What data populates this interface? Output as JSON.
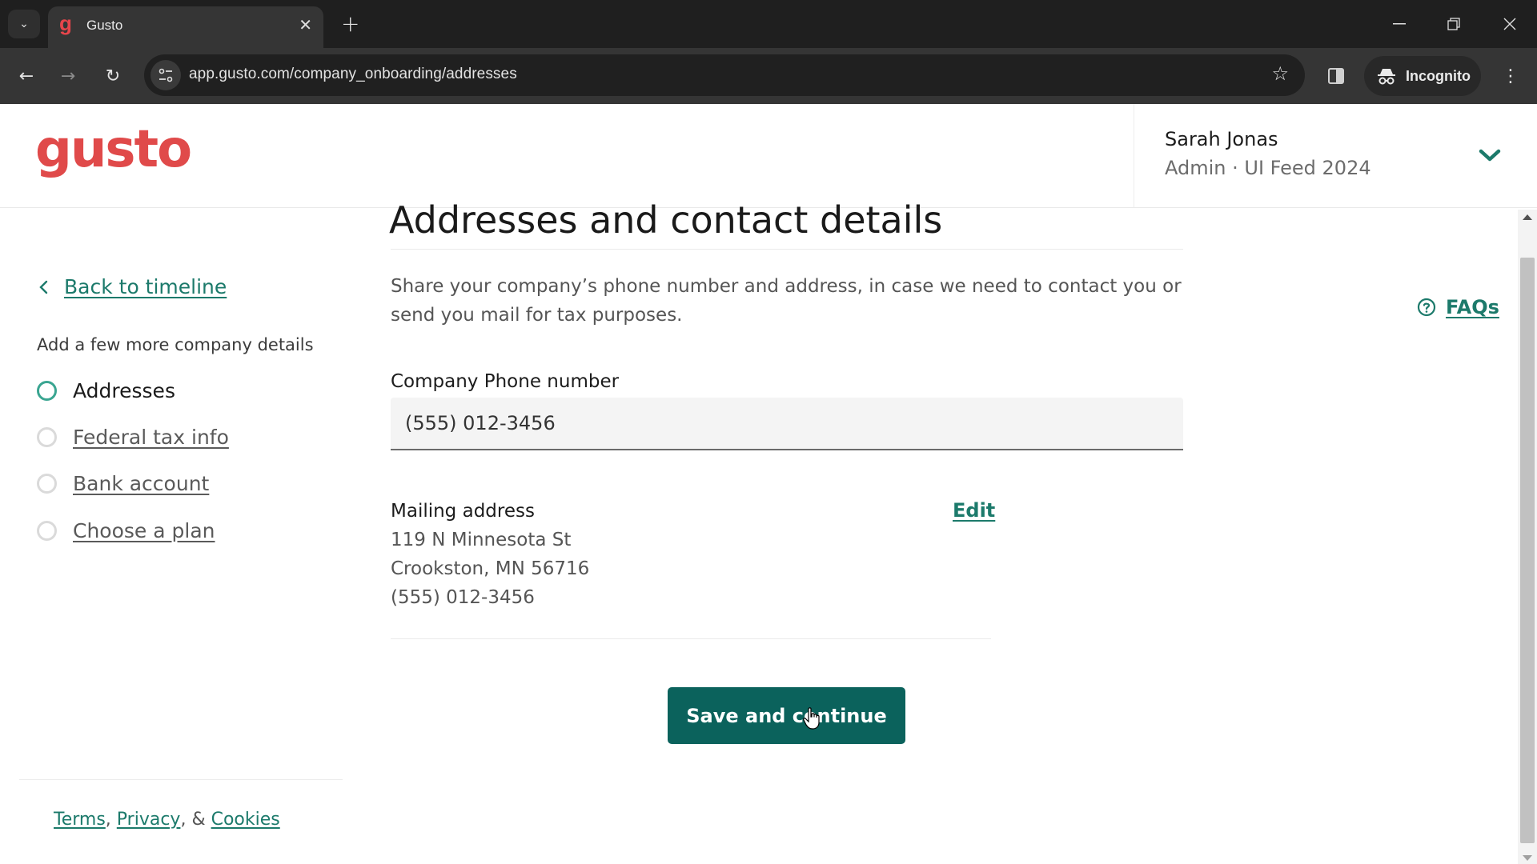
{
  "browser": {
    "tab_title": "Gusto",
    "tab_favicon": "g",
    "url": "app.gusto.com/company_onboarding/addresses",
    "incognito_label": "Incognito",
    "icons": {
      "tab_list": "⌄",
      "tab_close": "✕",
      "new_tab": "+",
      "back": "←",
      "forward": "→",
      "reload": "↻",
      "site_info": "⚙",
      "bookmark": "☆",
      "menu": "⋮",
      "minimize": "—",
      "restore": "❐",
      "close": "✕"
    }
  },
  "header": {
    "logo": "gusto",
    "user_name": "Sarah Jonas",
    "user_subtitle": "Admin · UI Feed 2024"
  },
  "sidebar": {
    "back_label": "Back to timeline",
    "steps_title": "Add a few more company details",
    "steps": [
      {
        "label": "Addresses",
        "active": true
      },
      {
        "label": "Federal tax info",
        "active": false
      },
      {
        "label": "Bank account",
        "active": false
      },
      {
        "label": "Choose a plan",
        "active": false
      }
    ],
    "footer": {
      "terms": "Terms",
      "sep1": ",",
      "privacy": "Privacy",
      "sep2": ", &",
      "cookies": "Cookies"
    }
  },
  "main": {
    "title": "Addresses and contact details",
    "description": "Share your company’s phone number and address, in case we need to contact you or send you mail for tax purposes.",
    "faqs_label": "FAQs",
    "phone": {
      "label": "Company Phone number",
      "value": "(555) 012-3456"
    },
    "mailing": {
      "label": "Mailing address",
      "edit_label": "Edit",
      "lines": [
        "119 N Minnesota St",
        "Crookston, MN 56716",
        "(555) 012-3456"
      ]
    },
    "save_label": "Save and continue"
  },
  "colors": {
    "brand_red": "#e04a4a",
    "accent_green": "#1c7a6b",
    "button_bg": "#0b625c",
    "active_step": "#3aa591"
  }
}
